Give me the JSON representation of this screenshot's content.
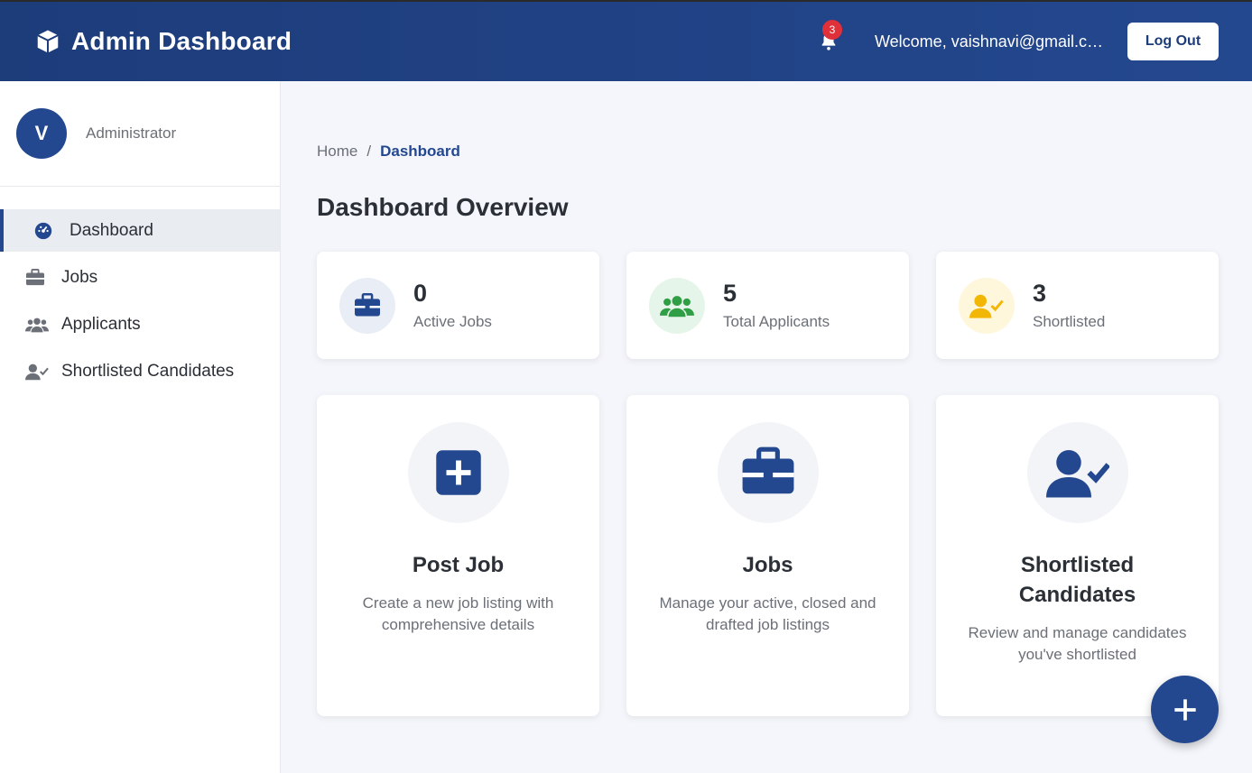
{
  "header": {
    "title": "Admin Dashboard",
    "notification_count": "3",
    "welcome": "Welcome, vaishnavi@gmail.com",
    "logout_label": "Log Out"
  },
  "sidebar": {
    "avatar_letter": "V",
    "role": "Administrator",
    "items": [
      {
        "label": "Dashboard",
        "icon": "gauge-icon",
        "active": true
      },
      {
        "label": "Jobs",
        "icon": "briefcase-icon"
      },
      {
        "label": "Applicants",
        "icon": "users-icon"
      },
      {
        "label": "Shortlisted Candidates",
        "icon": "user-check-icon"
      }
    ]
  },
  "breadcrumb": {
    "home": "Home",
    "separator": "/",
    "current": "Dashboard"
  },
  "page_title": "Dashboard Overview",
  "stats": [
    {
      "value": "0",
      "label": "Active Jobs",
      "icon": "briefcase-icon",
      "color": "#24488f",
      "bg": "#e9eef6"
    },
    {
      "value": "5",
      "label": "Total Applicants",
      "icon": "users-icon",
      "color": "#2f9e44",
      "bg": "#e6f5ea"
    },
    {
      "value": "3",
      "label": "Shortlisted",
      "icon": "user-check-icon",
      "color": "#f2b705",
      "bg": "#fff7dc"
    }
  ],
  "actions": [
    {
      "title": "Post Job",
      "desc": "Create a new job listing with comprehensive details",
      "icon": "plus-square-icon"
    },
    {
      "title": "Jobs",
      "desc": "Manage your active, closed and drafted job listings",
      "icon": "briefcase-icon"
    },
    {
      "title": "Shortlisted Candidates",
      "desc": "Review and manage candidates you've shortlisted",
      "icon": "user-check-icon"
    }
  ],
  "colors": {
    "primary": "#24488f",
    "header_start": "#1d3c7a",
    "badge": "#e0303a"
  }
}
